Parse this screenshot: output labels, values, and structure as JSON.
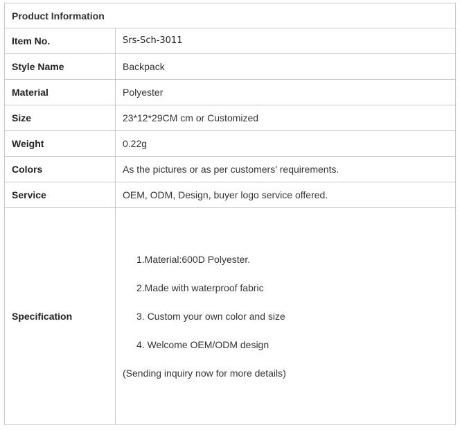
{
  "title": "Product Information",
  "rows": [
    {
      "label": "Item No.",
      "value": "Srs-Sch-3011"
    },
    {
      "label": "Style Name",
      "value": "Backpack"
    },
    {
      "label": "Material",
      "value": "Polyester"
    },
    {
      "label": "Size",
      "value": "23*12*29CM cm or Customized"
    },
    {
      "label": "Weight",
      "value": "0.22g"
    },
    {
      "label": "Colors",
      "value": "As the pictures or as per customers' requirements."
    },
    {
      "label": "Service",
      "value": "OEM, ODM, Design, buyer logo service offered."
    }
  ],
  "specification": {
    "label": "Specification",
    "items": [
      "1.Material:600D Polyester.",
      "2.Made with waterproof fabric",
      "3. Custom your own color and size",
      "4. Welcome OEM/ODM design"
    ],
    "note": "(Sending inquiry now for more details)"
  }
}
